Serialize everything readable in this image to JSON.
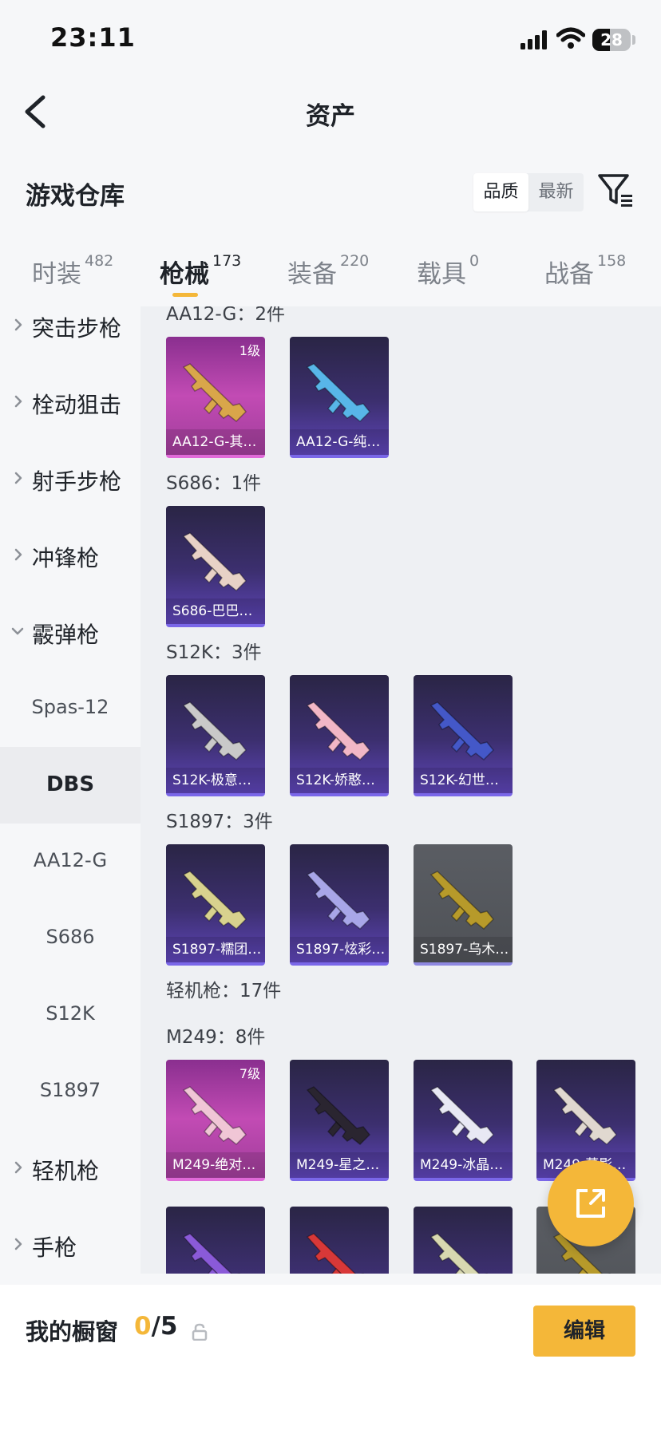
{
  "status_bar": {
    "time": "23:11",
    "battery": "28"
  },
  "header": {
    "title": "资产"
  },
  "warehouse": {
    "title": "游戏仓库",
    "sort_options": [
      "品质",
      "最新"
    ],
    "sort_selected": "品质"
  },
  "tabs": [
    {
      "label": "时装",
      "count": "482"
    },
    {
      "label": "枪械",
      "count": "173",
      "active": true
    },
    {
      "label": "装备",
      "count": "220"
    },
    {
      "label": "载具",
      "count": "0"
    },
    {
      "label": "战备",
      "count": "158"
    }
  ],
  "sidenav": [
    {
      "label": "突击步枪",
      "type": "category"
    },
    {
      "label": "栓动狙击",
      "type": "category"
    },
    {
      "label": "射手步枪",
      "type": "category"
    },
    {
      "label": "冲锋枪",
      "type": "category"
    },
    {
      "label": "霰弹枪",
      "type": "category",
      "expanded": true
    },
    {
      "label": "Spas-12",
      "type": "sub"
    },
    {
      "label": "DBS",
      "type": "sub",
      "selected": true
    },
    {
      "label": "AA12-G",
      "type": "sub"
    },
    {
      "label": "S686",
      "type": "sub"
    },
    {
      "label": "S12K",
      "type": "sub"
    },
    {
      "label": "S1897",
      "type": "sub"
    },
    {
      "label": "轻机枪",
      "type": "category"
    },
    {
      "label": "手枪",
      "type": "category"
    }
  ],
  "groups": [
    {
      "title": "AA12-G：2件",
      "items": [
        {
          "name": "AA12-G-其…",
          "level": "1级",
          "style": "pink",
          "color": "#d9a64a"
        },
        {
          "name": "AA12-G-纯…",
          "style": "purple",
          "color": "#58b6e8"
        }
      ]
    },
    {
      "title": "S686：1件",
      "items": [
        {
          "name": "S686-巴巴…",
          "style": "purple",
          "color": "#e8d2c6"
        }
      ]
    },
    {
      "title": "S12K：3件",
      "items": [
        {
          "name": "S12K-极意…",
          "style": "purple",
          "color": "#c9c9c9"
        },
        {
          "name": "S12K-娇憨…",
          "style": "purple",
          "color": "#f2b7c6"
        },
        {
          "name": "S12K-幻世…",
          "style": "purple",
          "color": "#4458c8"
        }
      ]
    },
    {
      "title": "S1897：3件",
      "items": [
        {
          "name": "S1897-糯团…",
          "style": "purple",
          "color": "#d8d28e"
        },
        {
          "name": "S1897-炫彩…",
          "style": "purple",
          "color": "#a8a6e8"
        },
        {
          "name": "S1897-乌木…",
          "style": "grey",
          "color": "#b79a2a"
        }
      ]
    },
    {
      "title": "轻机枪：17件",
      "items": []
    },
    {
      "title": "M249：8件",
      "items": [
        {
          "name": "M249-绝对…",
          "level": "7级",
          "style": "pink",
          "color": "#f0c6d6"
        },
        {
          "name": "M249-星之…",
          "style": "purple",
          "color": "#2a2530"
        },
        {
          "name": "M249-冰晶…",
          "style": "purple",
          "color": "#e8e8f4"
        },
        {
          "name": "M249-幕影…",
          "style": "purple",
          "color": "#e0d8d0"
        },
        {
          "name": "",
          "style": "purple",
          "color": "#8a5ad8"
        },
        {
          "name": "",
          "style": "purple",
          "color": "#d83838"
        },
        {
          "name": "",
          "style": "purple",
          "color": "#d8d8b0"
        },
        {
          "name": "",
          "style": "grey",
          "color": "#b79a2a"
        }
      ]
    }
  ],
  "bottom_bar": {
    "label": "我的橱窗",
    "current": "0",
    "total": "/5",
    "edit_label": "编辑"
  },
  "colors": {
    "accent": "#f4b739",
    "rarity_purple": "#5e45b8",
    "rarity_pink": "#c24bb4"
  }
}
